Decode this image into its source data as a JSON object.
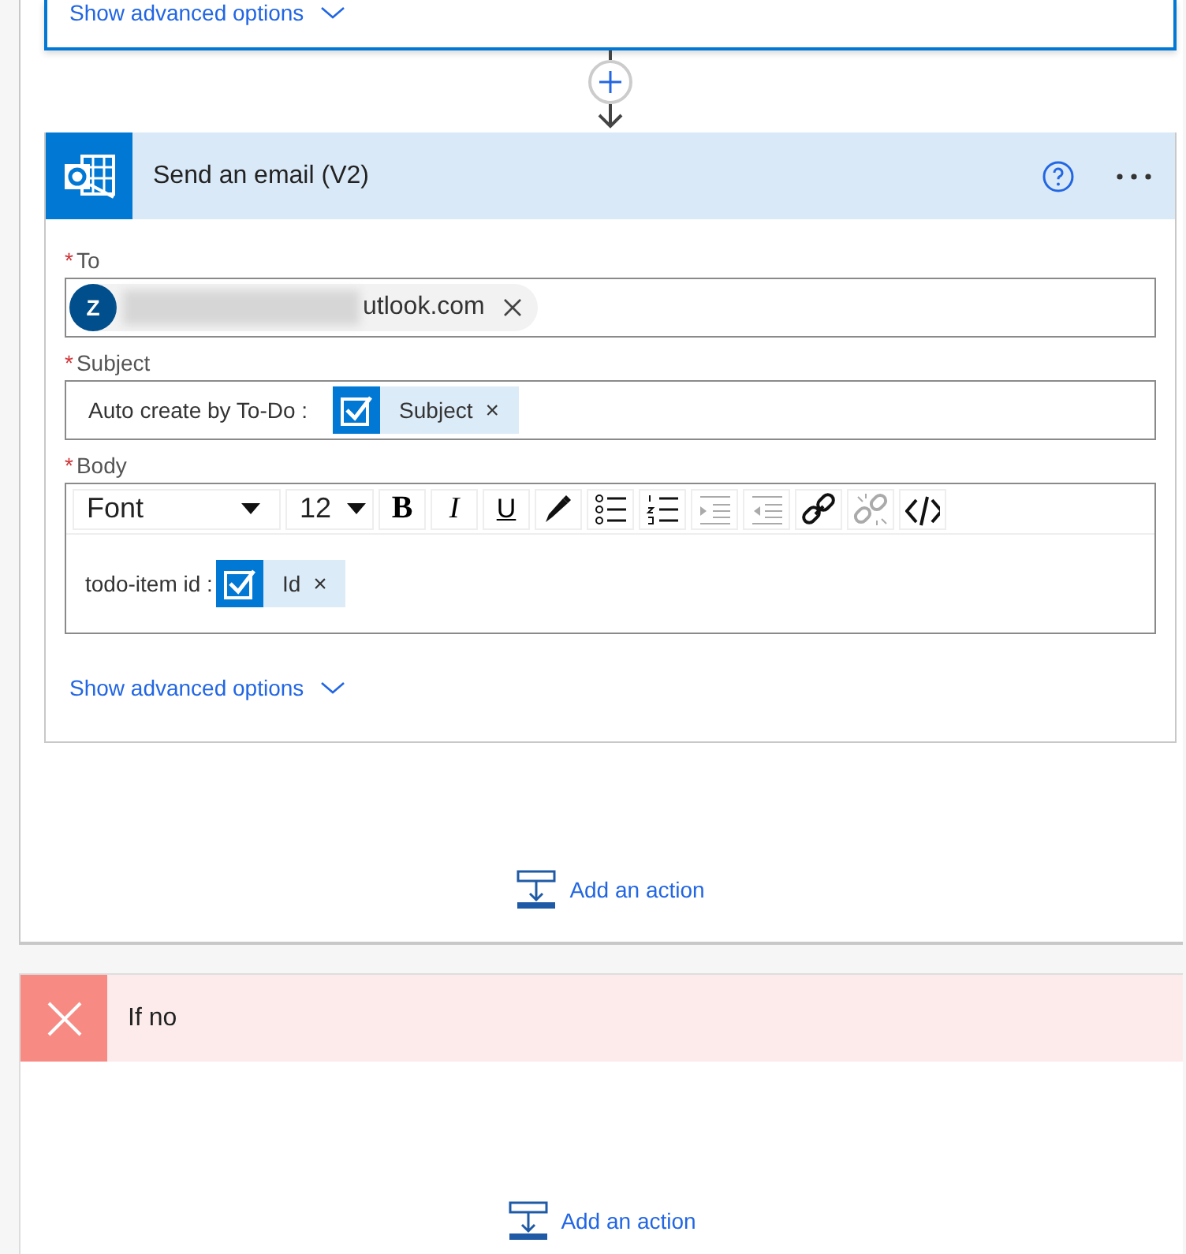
{
  "previous_step": {
    "advanced_link": "Show advanced options"
  },
  "action": {
    "title": "Send an email (V2)",
    "fields": [
      {
        "kind": "recipients",
        "label": "To",
        "required_mark": "*",
        "tokens": [
          {
            "initial": "Z",
            "text": "utlook.com"
          }
        ]
      },
      {
        "kind": "text",
        "label": "Subject",
        "required_mark": "*",
        "prefix": "Auto create by To-Do :",
        "tokens": [
          {
            "text": "Subject",
            "remove": "×"
          }
        ]
      },
      {
        "kind": "richtext",
        "label": "Body",
        "required_mark": "*",
        "font": "Font",
        "size": "12",
        "toolbar": [
          {
            "kind": "bold",
            "label": "B",
            "disabled": false
          },
          {
            "kind": "italic",
            "label": "I",
            "disabled": false
          },
          {
            "kind": "underline",
            "label": "U",
            "disabled": false
          },
          {
            "kind": "color",
            "disabled": false
          },
          {
            "kind": "bullets",
            "disabled": false
          },
          {
            "kind": "numbering",
            "disabled": false
          },
          {
            "kind": "indent",
            "disabled": true
          },
          {
            "kind": "outdent",
            "disabled": true
          },
          {
            "kind": "link",
            "disabled": false
          },
          {
            "kind": "unlink",
            "disabled": true
          },
          {
            "kind": "code",
            "disabled": false
          }
        ],
        "prefix": "todo-item id :",
        "tokens": [
          {
            "text": "Id",
            "remove": "×"
          }
        ]
      }
    ],
    "advanced_link": "Show advanced options",
    "add_action": "Add an action"
  },
  "branch": {
    "title": "If no",
    "add_action": "Add an action"
  }
}
